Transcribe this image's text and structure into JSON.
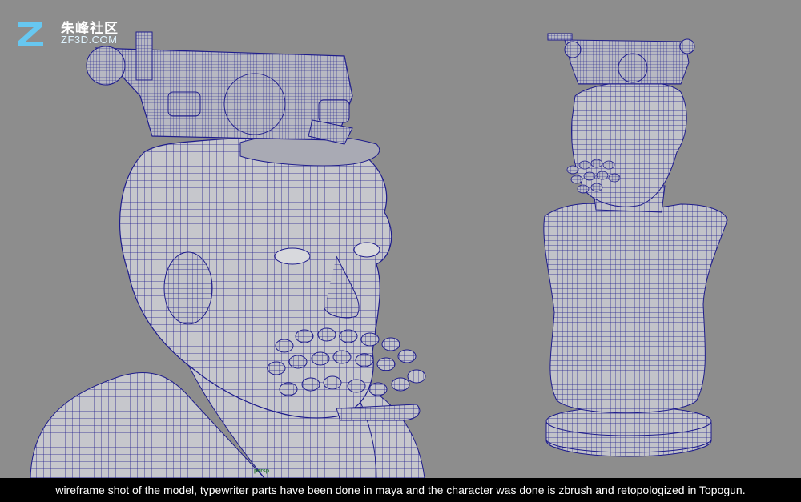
{
  "logo": {
    "cn_text": "朱峰社区",
    "en_text": "ZF3D.COM",
    "mark_icon": "z-logo-icon",
    "mark_color": "#67c7f0"
  },
  "viewport": {
    "label": "persp"
  },
  "caption": {
    "text": "wireframe shot of the model, typewriter parts have been done in maya and the character was done is zbrush and retopologized in Topogun."
  },
  "colors": {
    "background": "#8d8d8d",
    "mesh_surface": "#c8c9ce",
    "wireframe": "#1b1a8a",
    "caption_bar": "#000000"
  }
}
